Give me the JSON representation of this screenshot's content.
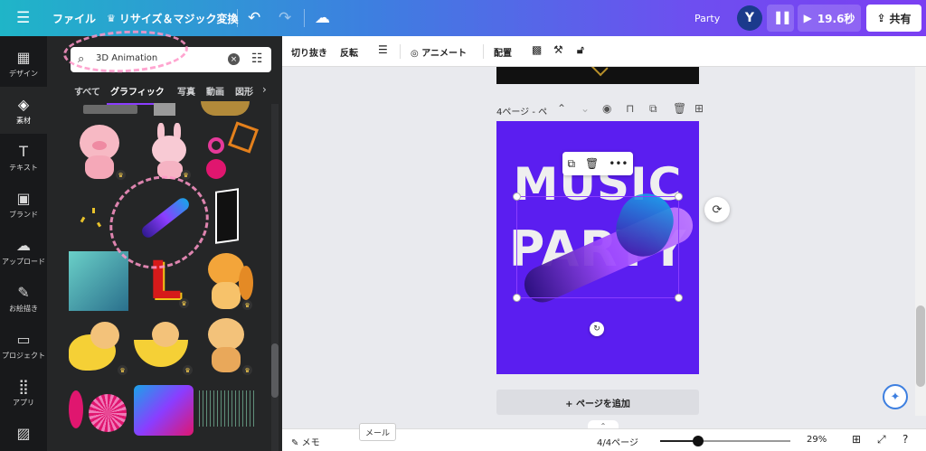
{
  "topbar": {
    "menu_icon": "hamburger-icon",
    "file_label": "ファイル",
    "resize_label": "リサイズ＆マジック変換",
    "design_title": "Party",
    "avatar_initial": "Y",
    "play_time": "19.6秒",
    "share_label": "共有"
  },
  "rail": {
    "items": [
      {
        "label": "デザイン",
        "icon": "▦"
      },
      {
        "label": "素材",
        "icon": "◈"
      },
      {
        "label": "テキスト",
        "icon": "T"
      },
      {
        "label": "ブランド",
        "icon": "▣"
      },
      {
        "label": "アップロード",
        "icon": "☁"
      },
      {
        "label": "お絵描き",
        "icon": "✎"
      },
      {
        "label": "プロジェクト",
        "icon": "▭"
      },
      {
        "label": "アプリ",
        "icon": "⣿"
      }
    ]
  },
  "panel": {
    "search_value": "3D Animation",
    "tabs": [
      "すべて",
      "グラフィック",
      "写真",
      "動画",
      "図形"
    ]
  },
  "context_toolbar": {
    "crop": "切り抜き",
    "flip": "反転",
    "animate": "アニメート",
    "position": "配置"
  },
  "canvas": {
    "page_label": "4ページ - ペ",
    "line1": "MUSIC",
    "line2": "PARTY",
    "add_page": "+ ページを追加"
  },
  "bottombar": {
    "notes": "メモ",
    "tooltip": "メール",
    "page_count": "4/4ページ",
    "zoom": "29%",
    "zoom_fraction": 0.29
  },
  "colors": {
    "accent": "#8b3dff",
    "page_bg": "#5b1ef0"
  }
}
